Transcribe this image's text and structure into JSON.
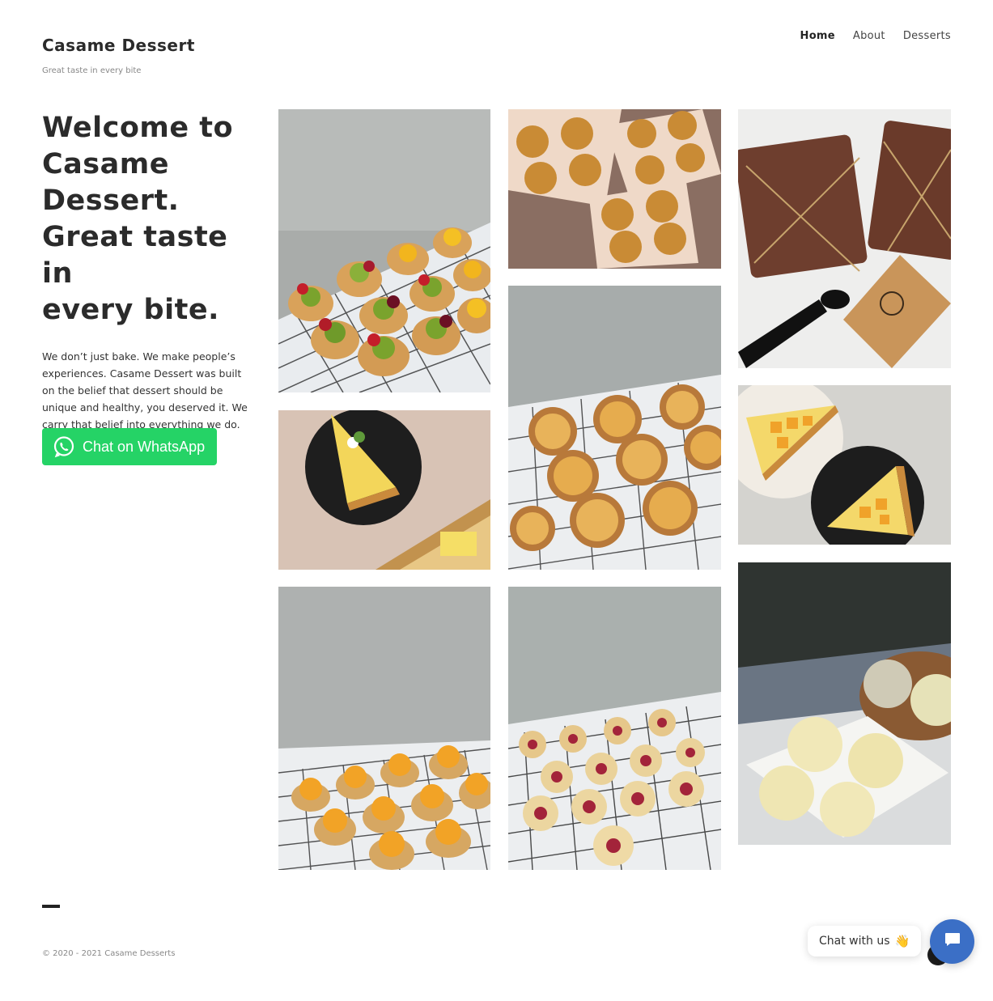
{
  "site": {
    "title": "Casame Dessert",
    "tagline": "Great taste in every bite"
  },
  "nav": {
    "items": [
      {
        "label": "Home",
        "active": true
      },
      {
        "label": "About",
        "active": false
      },
      {
        "label": "Desserts",
        "active": false
      }
    ]
  },
  "intro": {
    "heading_line1": "Welcome to",
    "heading_line2": "Casame",
    "heading_line3": "Dessert.",
    "heading_line4": "Great taste in",
    "heading_line5": "every bite.",
    "body": "We don’t just bake. We make people’s experiences. Casame Dessert was built on the belief that dessert should be unique and healthy, you deserved it. We carry that belief into everything we do."
  },
  "whatsapp": {
    "label": "Chat on WhatsApp",
    "color": "#25d366"
  },
  "gallery": {
    "items": [
      {
        "name": "fruit-tarts"
      },
      {
        "name": "lemon-tart-slice"
      },
      {
        "name": "mango-tarts"
      },
      {
        "name": "cream-puffs-box"
      },
      {
        "name": "egg-tarts"
      },
      {
        "name": "cheese-tarts"
      },
      {
        "name": "tiramisu-boxes"
      },
      {
        "name": "mango-tart-slices"
      },
      {
        "name": "mochi-box"
      }
    ]
  },
  "footer": {
    "copyright": "© 2020 - 2021 Casame Desserts"
  },
  "chat_widget": {
    "label": "Chat with us",
    "emoji": "👋",
    "color": "#3b6fc6"
  }
}
